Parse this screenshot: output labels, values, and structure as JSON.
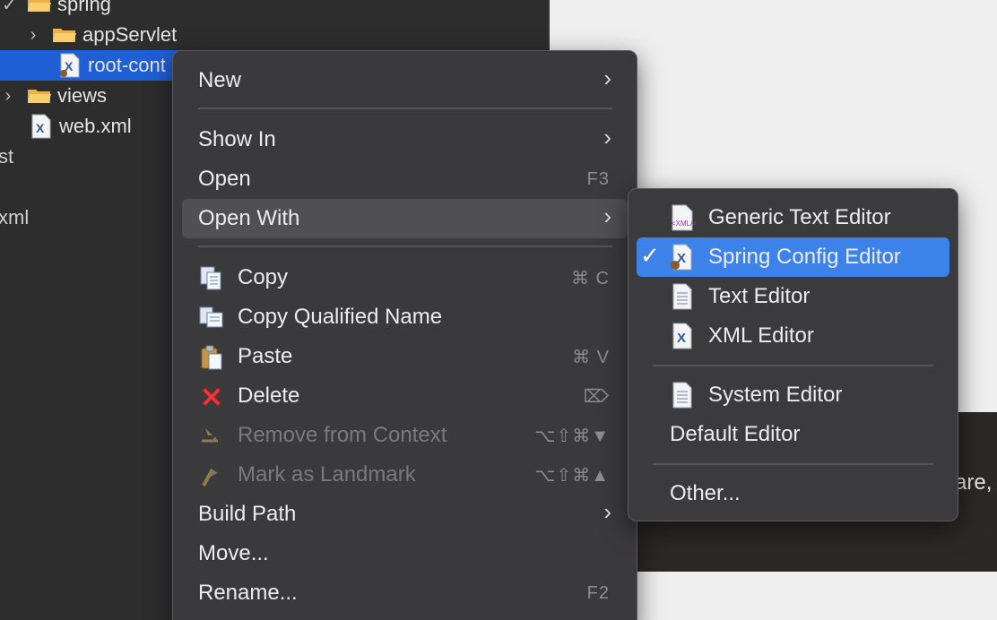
{
  "explorer": {
    "rows": [
      {
        "label": "spring",
        "expanded": true
      },
      {
        "label": "appServlet",
        "expanded": false
      },
      {
        "label": "root-cont",
        "selected": true
      },
      {
        "label": "views",
        "expanded": false
      },
      {
        "label": "web.xml"
      }
    ],
    "stray": [
      "st",
      "xml"
    ]
  },
  "editor": {
    "dark_fragment": "are,"
  },
  "menu": {
    "new": "New",
    "show_in": "Show In",
    "open": "Open",
    "open_shortcut": "F3",
    "open_with": "Open With",
    "copy": "Copy",
    "copy_shortcut": "⌘ C",
    "copy_qualified": "Copy Qualified Name",
    "paste": "Paste",
    "paste_shortcut": "⌘ V",
    "delete": "Delete",
    "delete_shortcut": "⌦",
    "remove_context": "Remove from Context",
    "remove_shortcut": "⌥⇧⌘▼",
    "mark_landmark": "Mark as Landmark",
    "mark_shortcut": "⌥⇧⌘▲",
    "build_path": "Build Path",
    "move": "Move...",
    "rename": "Rename...",
    "rename_shortcut": "F2"
  },
  "submenu": {
    "generic": "Generic Text Editor",
    "spring": "Spring Config Editor",
    "text": "Text Editor",
    "xml": "XML Editor",
    "system": "System Editor",
    "default": "Default Editor",
    "other": "Other...",
    "generic_icon_text": "<XML/>"
  },
  "colors": {
    "selection": "#3d82e8",
    "tree_selection": "#1f5fd6",
    "menu_bg": "#3a3a3c"
  }
}
